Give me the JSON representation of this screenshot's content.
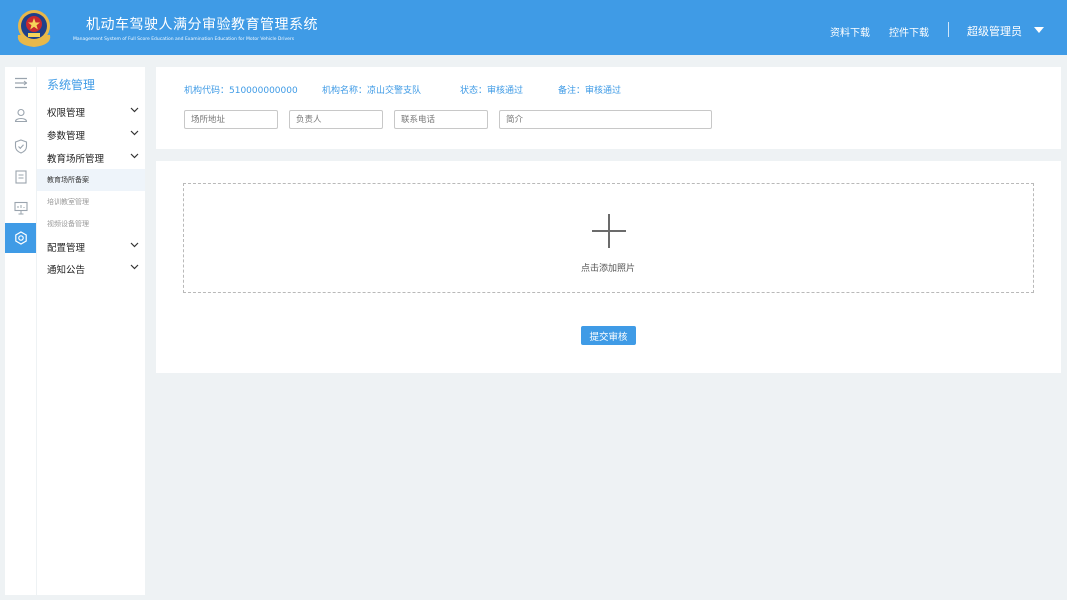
{
  "header": {
    "title_cn": "机动车驾驶人满分审验教育管理系统",
    "title_en": "Management System of Full Score Education and Examination Education for Motor Vehicle Drivers",
    "links": [
      "资料下载",
      "控件下载"
    ],
    "user": "超级管理员",
    "accent": "#3f9be6"
  },
  "rail": {
    "icons": [
      "menu-toggle-icon",
      "user-icon",
      "shield-icon",
      "document-icon",
      "presentation-icon",
      "settings-icon"
    ],
    "active_index": 5
  },
  "sidebar": {
    "title": "系统管理",
    "groups": [
      {
        "label": "权限管理"
      },
      {
        "label": "参数管理"
      },
      {
        "label": "教育场所管理",
        "children": [
          "教育场所备案",
          "培训教室管理",
          "视频设备管理"
        ]
      },
      {
        "label": "配置管理"
      },
      {
        "label": "通知公告"
      }
    ],
    "active_child": "教育场所备案"
  },
  "info": {
    "org_code": "机构代码：510000000000",
    "org_name": "机构名称：凉山交警支队",
    "status": "状态：审核通过",
    "remark": "备注：审核通过",
    "fields": {
      "address_placeholder": "场所地址",
      "person_placeholder": "负责人",
      "phone_placeholder": "联系电话",
      "intro_placeholder": "简介"
    }
  },
  "upload": {
    "hint": "点击添加照片",
    "submit": "提交审核"
  }
}
